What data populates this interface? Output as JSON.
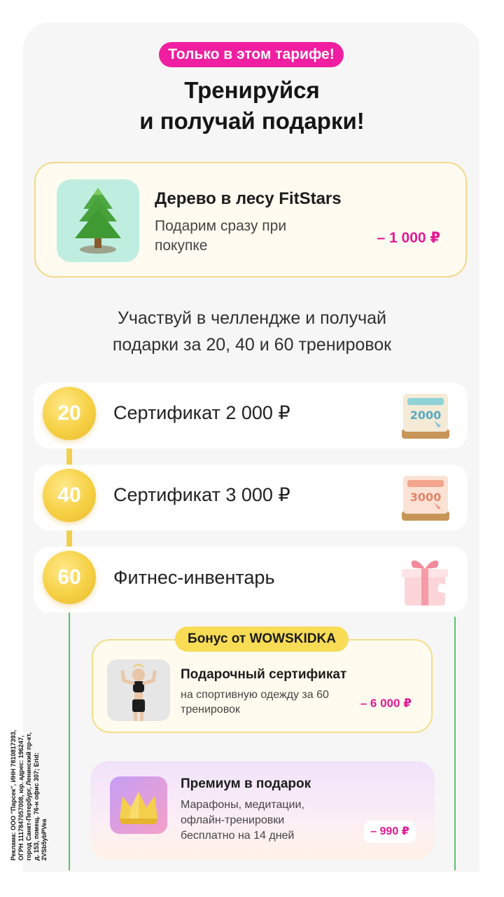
{
  "promo": {
    "badge": "Только в этом тарифе!",
    "headline_line1": "Тренируйся",
    "headline_line2": "и получай подарки!"
  },
  "tree_offer": {
    "title": "Дерево в лесу FitStars",
    "subtitle": "Подарим сразу при покупке",
    "price": "– 1 000 ₽",
    "icon": "tree-icon"
  },
  "challenge": {
    "text_line1": "Участвуй в челлендже и получай",
    "text_line2": "подарки за 20, 40 и 60 тренировок",
    "steps": [
      {
        "count": "20",
        "label": "Сертификат 2 000 ₽",
        "icon": "certificate-2000-icon",
        "image_text": "2000"
      },
      {
        "count": "40",
        "label": "Сертификат 3 000 ₽",
        "icon": "certificate-3000-icon",
        "image_text": "3000"
      },
      {
        "count": "60",
        "label": "Фитнес-инвентарь",
        "icon": "gift-box-icon"
      }
    ]
  },
  "bonus": {
    "tag": "Бонус от WOWSKIDKA",
    "certificate": {
      "title": "Подарочный сертификат",
      "subtitle": "на спортивную одежду за 60 тренировок",
      "price": "– 6 000 ₽"
    },
    "premium": {
      "title": "Премиум в подарок",
      "subtitle": "Марафоны, медитации, офлайн-тренировки бесплатно на 14 дней",
      "price": "– 990 ₽",
      "icon": "crown-icon"
    }
  },
  "legal": "Реклама: ООО \"Парсек\", ИНН 7810817393, ОГРН 1117847057008, юр. адрес: 196247, город Санкт-Петербург, Ленинский пр-кт, д. 153, помещ. 76-н офис 307; Erid: 2VSb5ybPVea",
  "colors": {
    "accent_pink": "#e41a95",
    "badge_pink": "#f01ea1",
    "gold": "#f6d044",
    "green_line": "#58c36a"
  }
}
